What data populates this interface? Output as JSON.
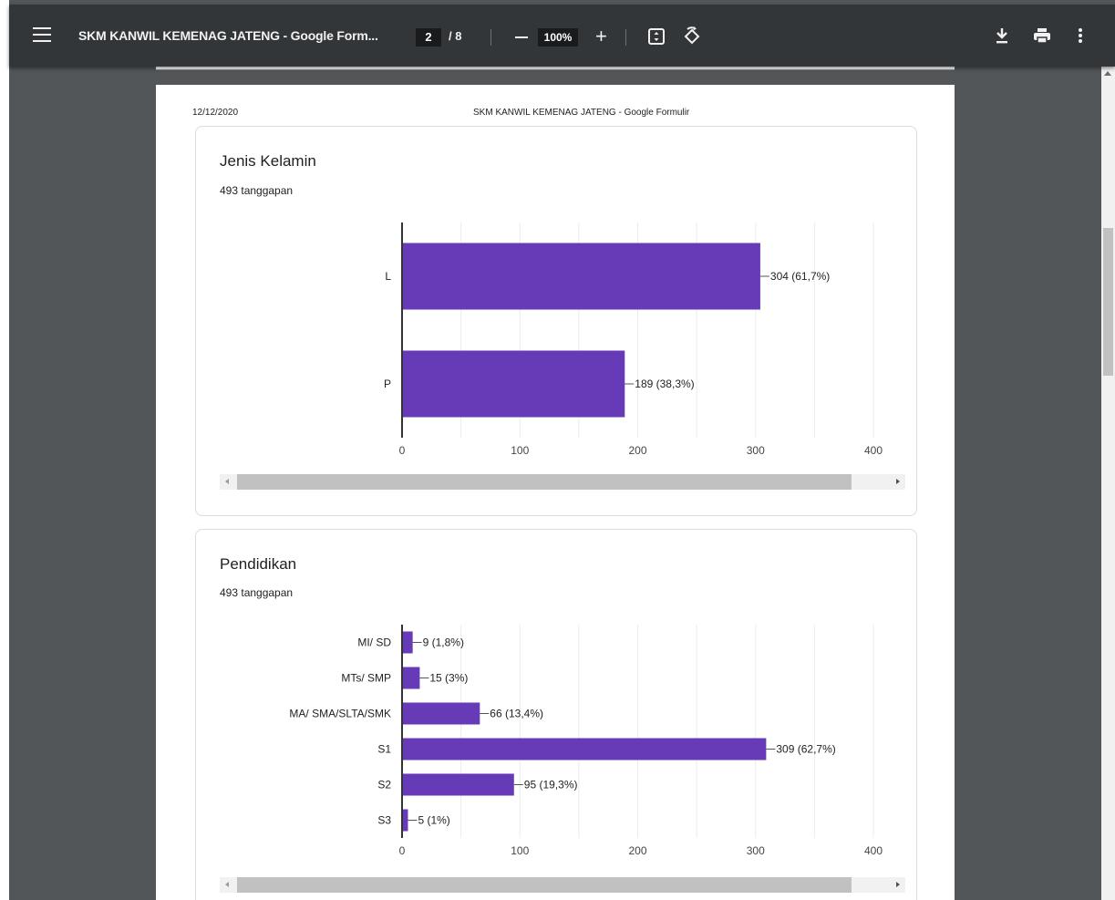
{
  "toolbar": {
    "title": "SKM KANWIL KEMENAG JATENG - Google Form...",
    "current_page": "2",
    "page_separator": "/",
    "total_pages": "8",
    "zoom": "100%",
    "zoom_in_label": "+",
    "icons": [
      "menu-icon",
      "fit-page-icon",
      "rotate-icon",
      "download-icon",
      "print-icon",
      "more-vert-icon"
    ]
  },
  "page_header": {
    "date": "12/12/2020",
    "doc_title": "SKM KANWIL KEMENAG JATENG - Google Formulir"
  },
  "chart_data": [
    {
      "type": "bar",
      "orientation": "horizontal",
      "title": "Jenis Kelamin",
      "subtitle": "493 tanggapan",
      "categories": [
        "L",
        "P"
      ],
      "values": [
        304,
        189
      ],
      "data_labels": [
        "304 (61,7%)",
        "189 (38,3%)"
      ],
      "xlim": [
        0,
        400
      ],
      "xticks": [
        "0",
        "100",
        "200",
        "300",
        "400"
      ],
      "color": "#673ab7",
      "grid": true
    },
    {
      "type": "bar",
      "orientation": "horizontal",
      "title": "Pendidikan",
      "subtitle": "493 tanggapan",
      "categories": [
        "MI/ SD",
        "MTs/ SMP",
        "MA/ SMA/SLTA/SMK",
        "S1",
        "S2",
        "S3"
      ],
      "values": [
        9,
        15,
        66,
        309,
        95,
        5
      ],
      "data_labels": [
        "9 (1,8%)",
        "15 (3%)",
        "66 (13,4%)",
        "309 (62,7%)",
        "95 (19,3%)",
        "5 (1%)"
      ],
      "xlim": [
        0,
        400
      ],
      "xticks": [
        "0",
        "100",
        "200",
        "300",
        "400"
      ],
      "color": "#673ab7",
      "grid": true
    }
  ]
}
